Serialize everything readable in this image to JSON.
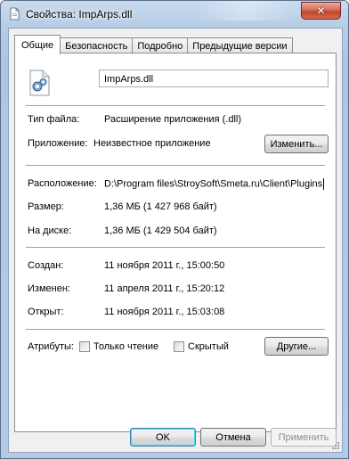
{
  "window": {
    "title": "Свойства: ImpArps.dll",
    "close_glyph": "✕",
    "accent_close": "#c1462e"
  },
  "tabs": [
    {
      "label": "Общие",
      "active": true
    },
    {
      "label": "Безопасность",
      "active": false
    },
    {
      "label": "Подробно",
      "active": false
    },
    {
      "label": "Предыдущие версии",
      "active": false
    }
  ],
  "general": {
    "file_name": "ImpArps.dll",
    "file_type_label": "Тип файла:",
    "file_type_value": "Расширение приложения (.dll)",
    "app_label": "Приложение:",
    "app_value": "Неизвестное приложение",
    "change_button": "Изменить...",
    "location_label": "Расположение:",
    "location_value": "D:\\Program files\\StroySoft\\Smeta.ru\\Client\\Plugins",
    "size_label": "Размер:",
    "size_value": "1,36 МБ (1 427 968 байт)",
    "disk_label": "На диске:",
    "disk_value": "1,36 МБ (1 429 504 байт)",
    "created_label": "Создан:",
    "created_value": "11 ноября 2011 г., 15:00:50",
    "modified_label": "Изменен:",
    "modified_value": "11 апреля 2011 г., 15:20:12",
    "accessed_label": "Открыт:",
    "accessed_value": "11 ноября 2011 г., 15:03:08",
    "attributes_label": "Атрибуты:",
    "readonly_label": "Только чтение",
    "readonly_checked": false,
    "hidden_label": "Скрытый",
    "hidden_checked": false,
    "other_button": "Другие..."
  },
  "footer": {
    "ok": "OK",
    "cancel": "Отмена",
    "apply": "Применить"
  }
}
